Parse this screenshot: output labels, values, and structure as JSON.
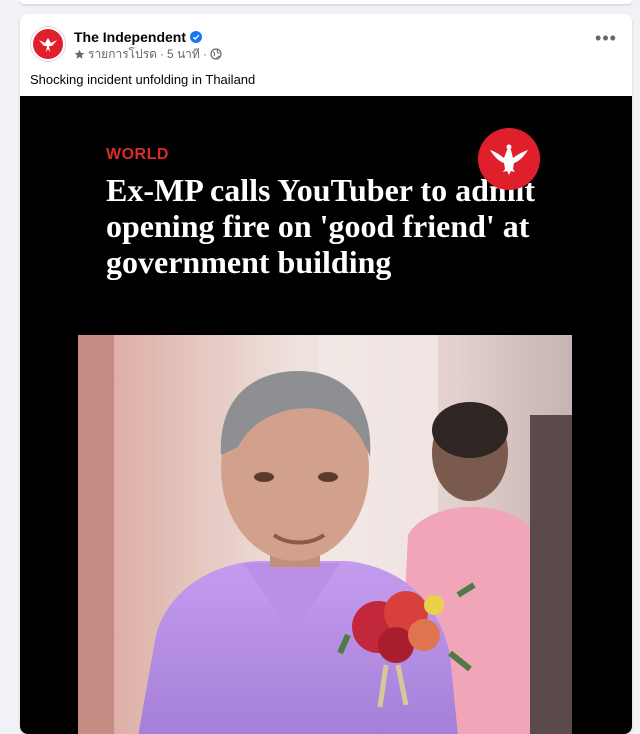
{
  "post": {
    "page_name": "The Independent",
    "verified": true,
    "meta": {
      "label": "รายการโปรด",
      "time": "5 นาที",
      "privacy_icon": "globe-icon",
      "favorite_icon": "star-icon"
    },
    "more_icon": "more-dots-icon",
    "caption": "Shocking incident unfolding in Thailand"
  },
  "media": {
    "section": "WORLD",
    "headline": "Ex-MP calls YouTuber to admit opening fire on 'good friend' at government building",
    "brand_icon": "eagle-logo-icon",
    "photo_alt": "Man in lavender jacket with red flower corsage"
  },
  "colors": {
    "brand_red": "#e01f2d",
    "section_red": "#d92b2b",
    "verified_blue": "#1877f2",
    "jacket_lavender": "#b68ee8"
  }
}
